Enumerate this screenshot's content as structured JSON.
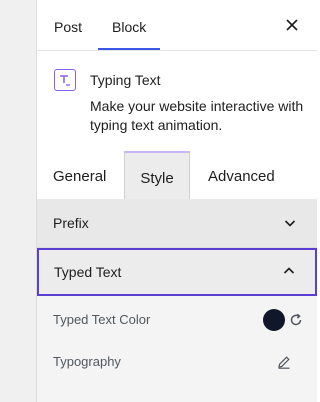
{
  "header": {
    "tabs": [
      {
        "label": "Post",
        "active": false
      },
      {
        "label": "Block",
        "active": true
      }
    ],
    "close_icon": "close-icon"
  },
  "block": {
    "icon": "typing-text-icon",
    "title": "Typing Text",
    "description": "Make your website interactive with typing text animation."
  },
  "settings_tabs": [
    {
      "label": "General",
      "active": false
    },
    {
      "label": "Style",
      "active": true
    },
    {
      "label": "Advanced",
      "active": false
    }
  ],
  "panels": [
    {
      "title": "Prefix",
      "expanded": false
    },
    {
      "title": "Typed Text",
      "expanded": true,
      "controls": [
        {
          "label": "Typed Text Color",
          "swatch_color": "#0f1729",
          "reset_icon": "reset-icon"
        },
        {
          "label": "Typography",
          "edit_icon": "pencil-icon"
        }
      ]
    }
  ],
  "colors": {
    "accent": "#3858e9",
    "focus": "#5b3fd4",
    "block_icon": "#8b5cf6"
  }
}
